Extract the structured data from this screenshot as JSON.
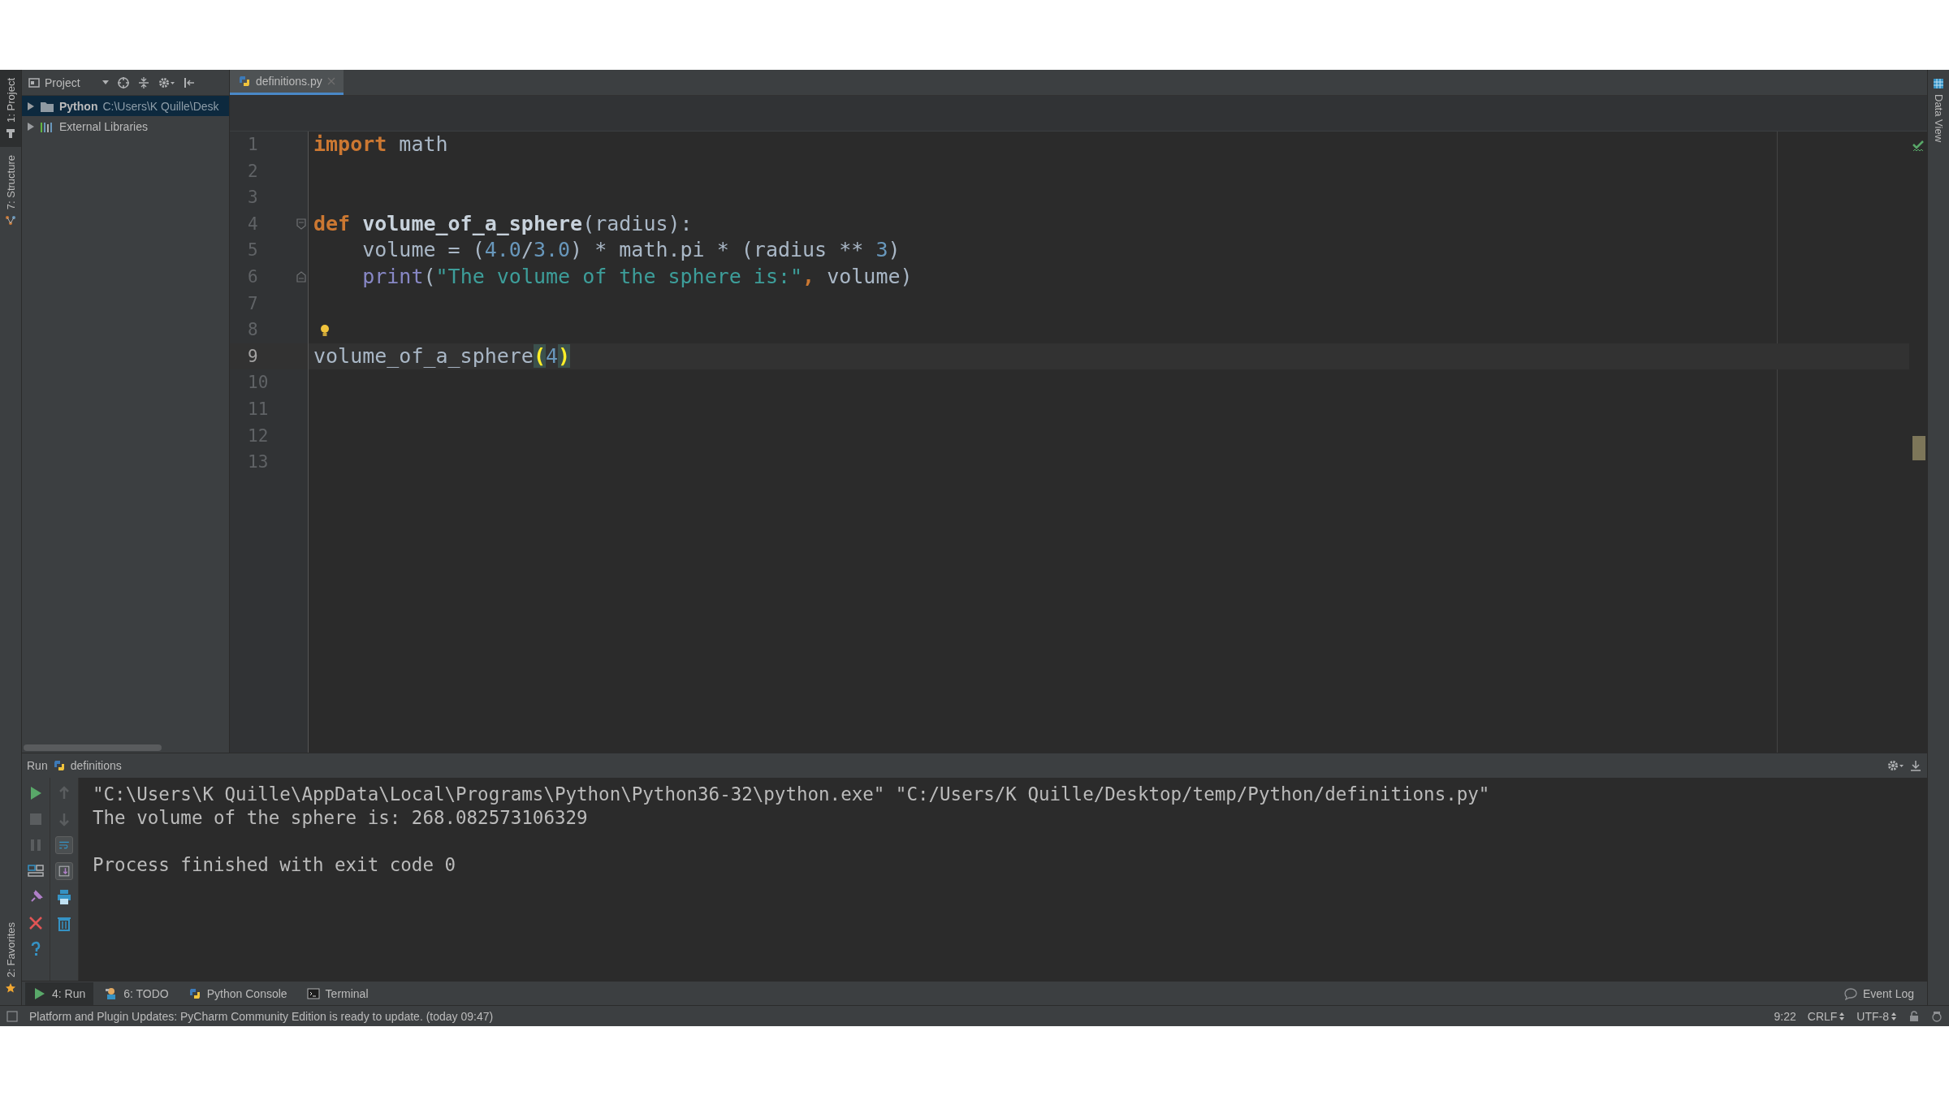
{
  "left_strip": {
    "tabs": [
      {
        "label": "1: Project",
        "selected": true
      },
      {
        "label": "7: Structure",
        "selected": false
      }
    ],
    "bottom_tabs": [
      {
        "label": "2: Favorites",
        "selected": false
      }
    ]
  },
  "project_panel": {
    "title": "Project",
    "tree": [
      {
        "label": "Python",
        "path": "C:\\Users\\K Quille\\Desk",
        "kind": "folder",
        "expanded": false,
        "selected": true
      },
      {
        "label": "External Libraries",
        "kind": "libraries",
        "expanded": false,
        "selected": false
      }
    ]
  },
  "editor": {
    "tabs": [
      {
        "label": "definitions.py",
        "selected": true
      }
    ],
    "lines": [
      {
        "number": "1",
        "kind": "plain",
        "current": false,
        "tokens": [
          {
            "kind": "keyword",
            "text": "import"
          },
          {
            "kind": "plain",
            "text": " math"
          }
        ]
      },
      {
        "number": "2",
        "kind": "plain",
        "current": false
      },
      {
        "number": "3",
        "kind": "plain",
        "current": false
      },
      {
        "number": "4",
        "kind": "fold_start",
        "current": false,
        "tokens": [
          {
            "kind": "keyword",
            "text": "def"
          },
          {
            "kind": "function",
            "text": " volume_of_a_sphere"
          },
          {
            "kind": "plain",
            "text": "(radius):"
          }
        ]
      },
      {
        "number": "5",
        "kind": "plain",
        "current": false,
        "tokens": [
          {
            "kind": "plain",
            "text": "    volume = ("
          },
          {
            "kind": "number",
            "text": "4.0"
          },
          {
            "kind": "plain",
            "text": "/"
          },
          {
            "kind": "number",
            "text": "3.0"
          },
          {
            "kind": "plain",
            "text": ") * math.pi * (radius ** "
          },
          {
            "kind": "number",
            "text": "3"
          },
          {
            "kind": "plain",
            "text": ")"
          }
        ]
      },
      {
        "number": "6",
        "kind": "fold_end",
        "current": false,
        "tokens": [
          {
            "kind": "builtin",
            "text": "    print"
          },
          {
            "kind": "plain",
            "text": "("
          },
          {
            "kind": "string",
            "text": "\"The volume of the sphere is:\""
          },
          {
            "kind": "keyword",
            "text": ", "
          },
          {
            "kind": "plain",
            "text": "volume)"
          }
        ]
      },
      {
        "number": "7",
        "kind": "plain",
        "current": false
      },
      {
        "number": "8",
        "kind": "hint",
        "current": false
      },
      {
        "number": "9",
        "kind": "plain",
        "current": true,
        "tokens": [
          {
            "kind": "plain",
            "text": "volume_of_a_sphere"
          },
          {
            "kind": "match",
            "text": "("
          },
          {
            "kind": "number",
            "text": "4"
          },
          {
            "kind": "match",
            "text": ")"
          }
        ]
      },
      {
        "number": "10",
        "kind": "plain",
        "current": false
      },
      {
        "number": "11",
        "kind": "plain",
        "current": false
      },
      {
        "number": "12",
        "kind": "plain",
        "current": false
      },
      {
        "number": "13",
        "kind": "plain",
        "current": false
      }
    ]
  },
  "right_strip": {
    "tabs": [
      {
        "label": "Data View",
        "selected": false
      }
    ]
  },
  "run_panel": {
    "title": "Run",
    "config": "definitions",
    "output": [
      {
        "kind": "command",
        "text": "\"C:\\Users\\K Quille\\AppData\\Local\\Programs\\Python\\Python36-32\\python.exe\" \"C:/Users/K Quille/Desktop/temp/Python/definitions.py\""
      },
      {
        "kind": "stdout",
        "text": "The volume of the sphere is: 268.082573106329"
      },
      {
        "kind": "exit",
        "text": "Process finished with exit code 0"
      }
    ]
  },
  "tool_tabs": [
    {
      "label": "4: Run",
      "kind": "run",
      "selected": true
    },
    {
      "label": "6: TODO",
      "kind": "todo",
      "selected": false
    },
    {
      "label": "Python Console",
      "kind": "console",
      "selected": false
    },
    {
      "label": "Terminal",
      "kind": "terminal",
      "selected": false
    }
  ],
  "event_log": "Event Log",
  "status_bar": {
    "message": "Platform and Plugin Updates: PyCharm Community Edition is ready to update. (today 09:47)",
    "position": "9:22",
    "line_separator": "CRLF",
    "encoding": "UTF-8"
  }
}
